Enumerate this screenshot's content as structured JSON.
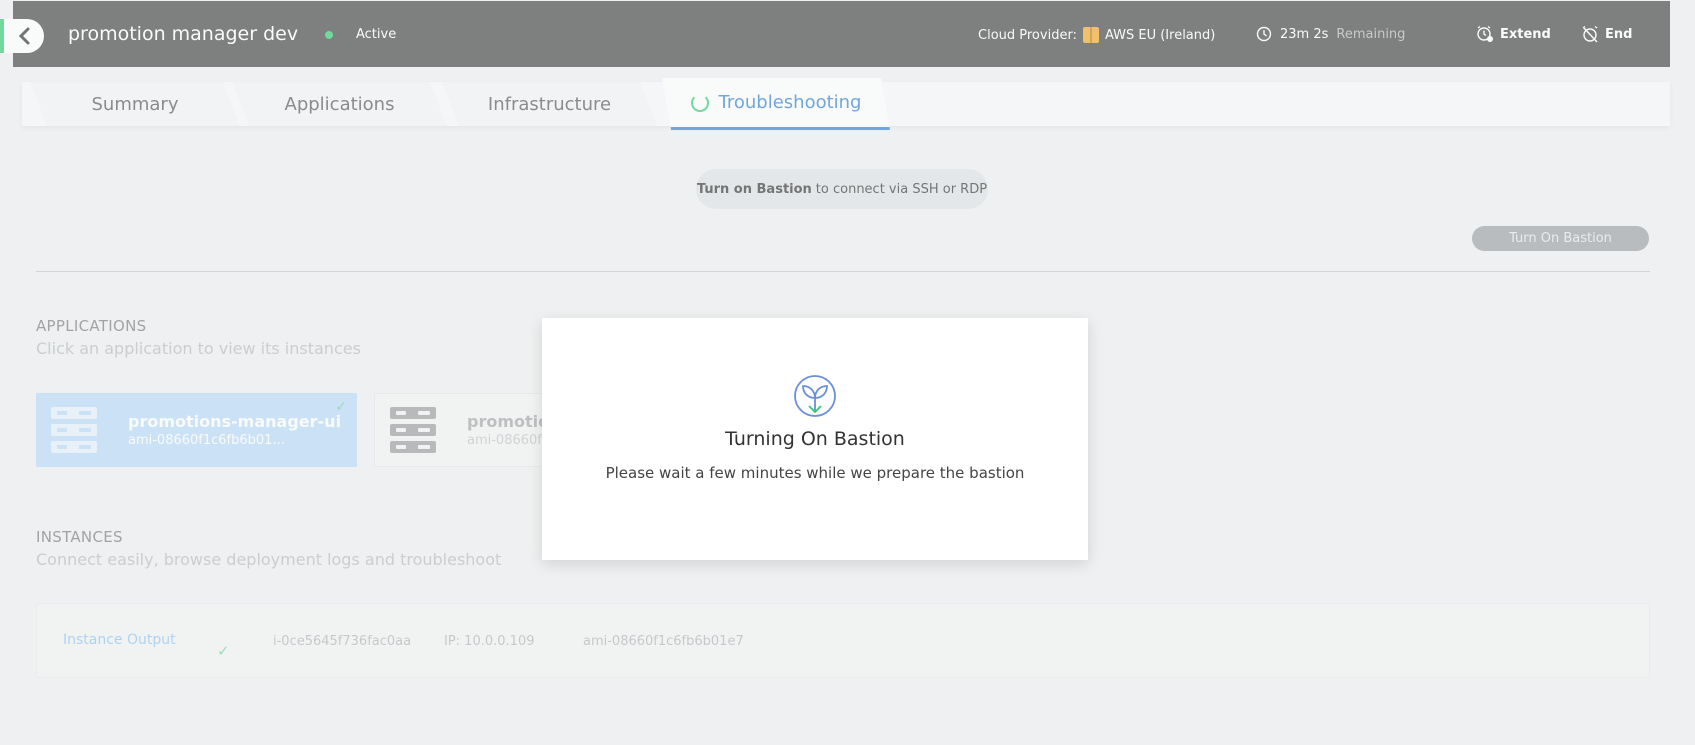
{
  "header": {
    "environment_name": "promotion manager dev",
    "status": "Active",
    "status_color": "#2ecc71",
    "cloud_provider_label": "Cloud Provider:",
    "cloud_provider_value": "AWS EU (Ireland)",
    "time_value": "23m 2s",
    "time_suffix": "Remaining",
    "extend_label": "Extend",
    "end_label": "End",
    "background_color": "#424242"
  },
  "tabs": [
    {
      "label": "Summary",
      "active": false
    },
    {
      "label": "Applications",
      "active": false
    },
    {
      "label": "Infrastructure",
      "active": false
    },
    {
      "label": "Troubleshooting",
      "active": true
    }
  ],
  "bastion": {
    "prompt_bold": "Turn on Bastion",
    "prompt_rest": "to connect via SSH or RDP",
    "button_label": "Turn On Bastion"
  },
  "applications": {
    "title": "APPLICATIONS",
    "subtitle": "Click an application to view its instances",
    "items": [
      {
        "name": "promotions-manager-ui",
        "ami": "ami-08660f1c6fb6b01...",
        "selected": true
      },
      {
        "name": "promotion",
        "ami": "ami-08660f",
        "selected": false
      }
    ]
  },
  "instances": {
    "title": "INSTANCES",
    "subtitle": "Connect easily, browse deployment logs and troubleshoot",
    "rows": [
      {
        "link": "Instance Output",
        "status_icon": "check-icon",
        "instance_id": "i-0ce5645f736fac0aa",
        "ip": "IP: 10.0.0.109",
        "ami": "ami-08660f1c6fb6b01e7"
      }
    ]
  },
  "modal": {
    "title": "Turning On Bastion",
    "message": "Please wait a few minutes while we prepare the bastion",
    "icon": "sprout-logo-icon"
  },
  "colors": {
    "accent": "#2d7fd3",
    "success": "#2ecc71",
    "selected_card": "#b9d9f7"
  }
}
